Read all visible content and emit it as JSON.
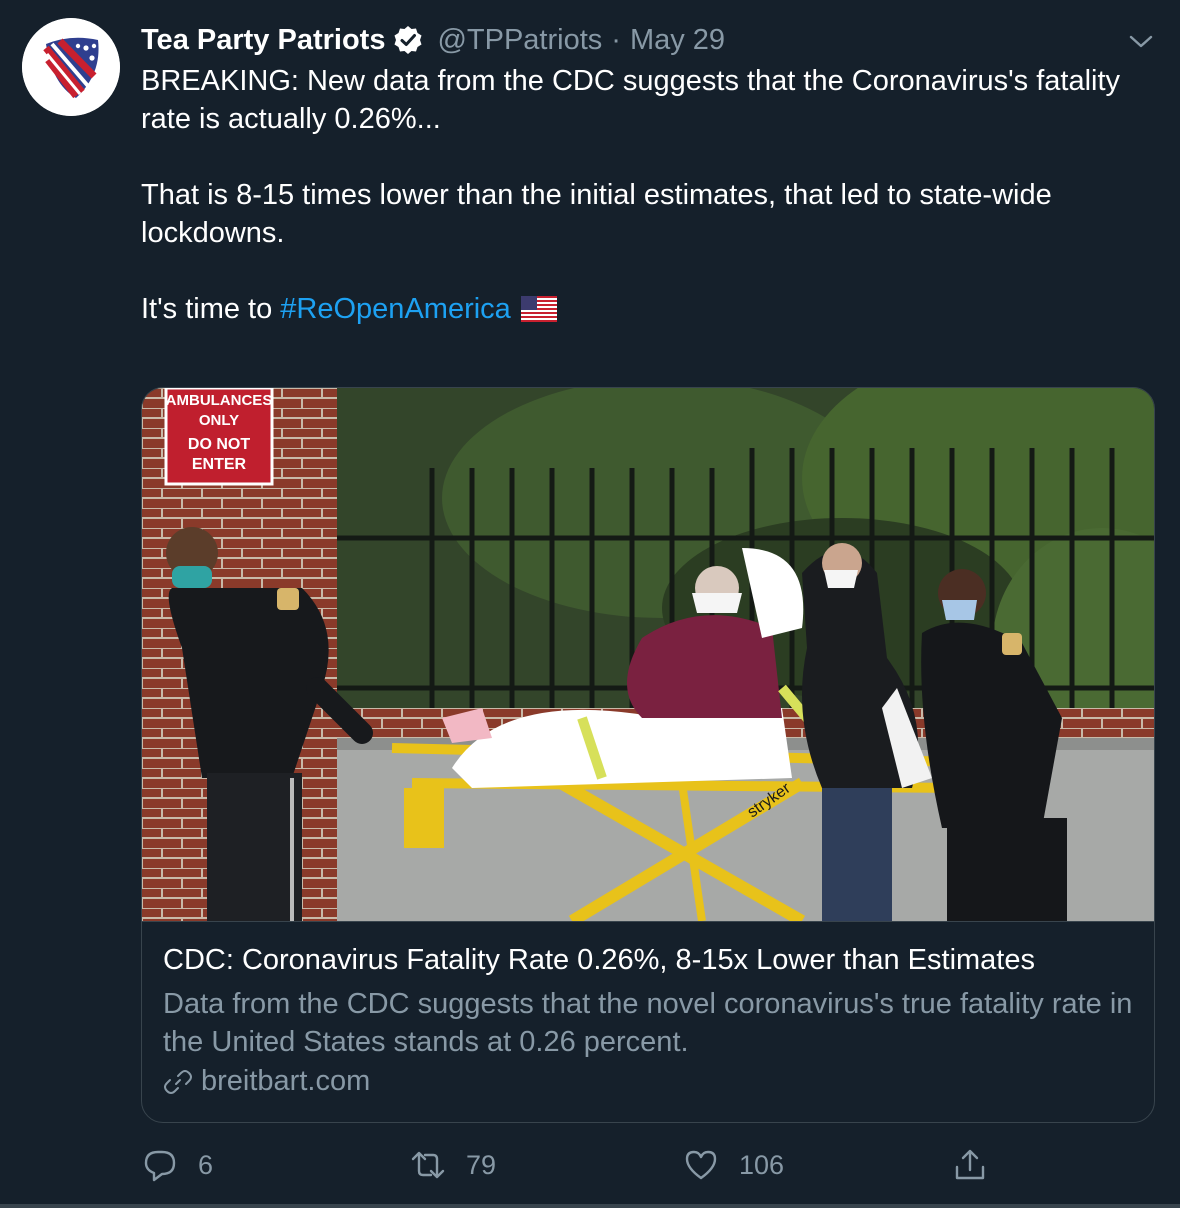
{
  "tweet": {
    "author_name": "Tea Party Patriots",
    "handle": "@TPPatriots",
    "separator": "·",
    "date": "May 29",
    "body_line1": "BREAKING: New data from the CDC suggests that the Coronavirus's fatality rate is actually 0.26%...",
    "body_line2": "That is 8-15 times lower than the initial estimates, that led to state-wide lockdowns.",
    "body_line3_prefix": "It's time to ",
    "hashtag": "#ReOpenAmerica"
  },
  "card": {
    "sign_line1": "AMBULANCES",
    "sign_line2": "ONLY",
    "sign_line3": "DO NOT",
    "sign_line4": "ENTER",
    "stretcher_brand": "stryker",
    "title": "CDC: Coronavirus Fatality Rate 0.26%, 8-15x Lower than Estimates",
    "description": "Data from the CDC suggests that the novel coronavirus's true fatality rate in the United States stands at 0.26 percent.",
    "domain": "breitbart.com"
  },
  "actions": {
    "replies": "6",
    "retweets": "79",
    "likes": "106"
  },
  "icons": {
    "reply": "speech-bubble-icon",
    "retweet": "retweet-arrows-icon",
    "like": "heart-icon",
    "share": "share-upload-icon",
    "verified": "verified-badge-icon",
    "more": "chevron-down-icon",
    "link": "link-icon",
    "flag": "us-flag-emoji"
  },
  "colors": {
    "background": "#15202b",
    "text": "#ffffff",
    "muted": "#8899a6",
    "accent": "#1da1f2",
    "border": "#38444d"
  }
}
